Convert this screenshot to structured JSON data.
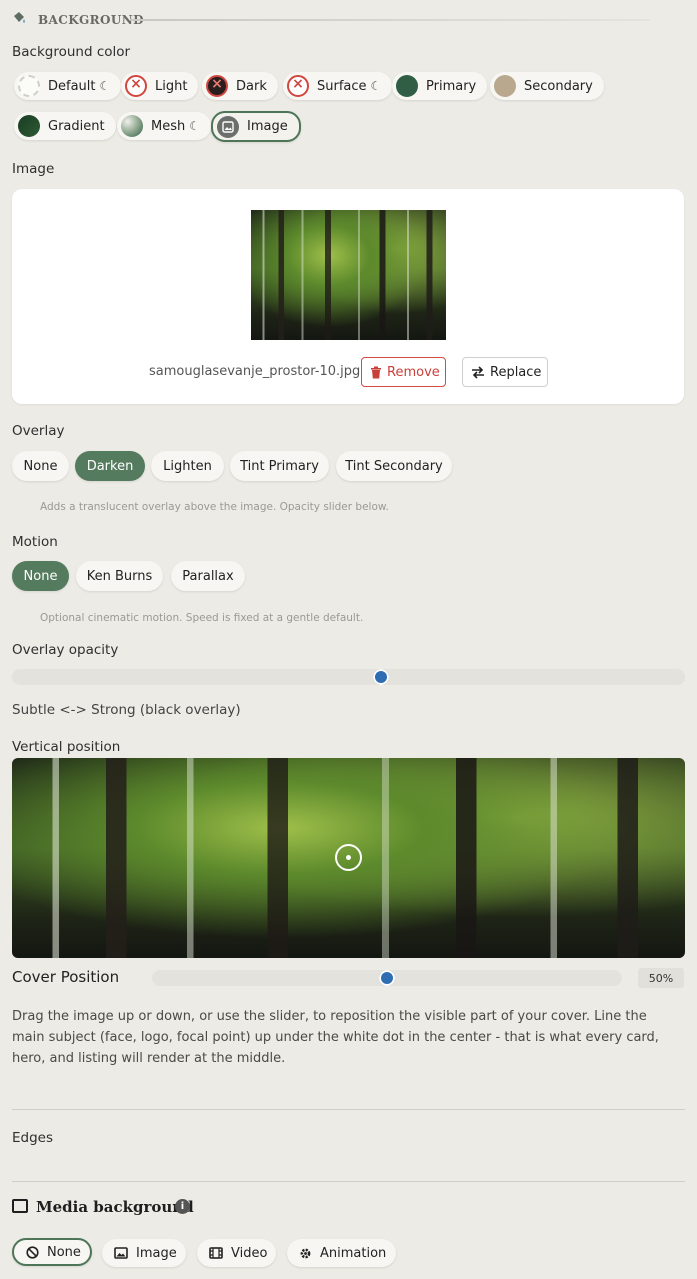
{
  "section": {
    "title": "BACKGROUND",
    "icon": "paint-bucket-icon"
  },
  "background_color": {
    "label": "Background color",
    "options": [
      {
        "label": "Default",
        "moon": "☾",
        "swatch": "default"
      },
      {
        "label": "Light",
        "moon": "",
        "swatch": "none"
      },
      {
        "label": "Dark",
        "moon": "",
        "swatch": "none-dark"
      },
      {
        "label": "Surface",
        "moon": "☾",
        "swatch": "none"
      },
      {
        "label": "Primary",
        "moon": "",
        "swatch": "#2f5e45"
      },
      {
        "label": "Secondary",
        "moon": "",
        "swatch": "#b9a88e"
      },
      {
        "label": "Gradient",
        "moon": "",
        "swatch": "#1f4a2a"
      },
      {
        "label": "Mesh",
        "moon": "☾",
        "swatch": "mesh"
      },
      {
        "label": "Image",
        "moon": "",
        "swatch": "image"
      }
    ],
    "selected": "Image"
  },
  "image": {
    "label": "Image",
    "filename": "samouglasevanje_prostor-10.jpg",
    "remove_label": "Remove",
    "replace_label": "Replace"
  },
  "overlay": {
    "label": "Overlay",
    "options": [
      "None",
      "Darken",
      "Lighten",
      "Tint Primary",
      "Tint Secondary"
    ],
    "selected": "Darken",
    "hint": "Adds a translucent overlay above the image. Opacity slider below."
  },
  "motion": {
    "label": "Motion",
    "options": [
      "None",
      "Ken Burns",
      "Parallax"
    ],
    "selected": "None",
    "hint": "Optional cinematic motion. Speed is fixed at a gentle default."
  },
  "overlay_opacity": {
    "label": "Overlay opacity",
    "value_fraction": 0.55,
    "caption": "Subtle <-> Strong (black overlay)"
  },
  "vertical_position": {
    "label": "Vertical position",
    "cover_label": "Cover Position",
    "value": "50%",
    "value_fraction": 0.5,
    "help": "Drag the image up or down, or use the slider, to reposition the visible part of your cover. Line the main subject (face, logo, focal point) up under the white dot in the center - that is what every card, hero, and listing will render at the middle."
  },
  "edges": {
    "label": "Edges"
  },
  "media_background": {
    "title": "Media background",
    "info_icon": "info-icon",
    "options": [
      {
        "label": "None",
        "icon": "ban-icon"
      },
      {
        "label": "Image",
        "icon": "image-icon"
      },
      {
        "label": "Video",
        "icon": "film-icon"
      },
      {
        "label": "Animation",
        "icon": "gear-icon"
      }
    ],
    "selected": "None"
  }
}
